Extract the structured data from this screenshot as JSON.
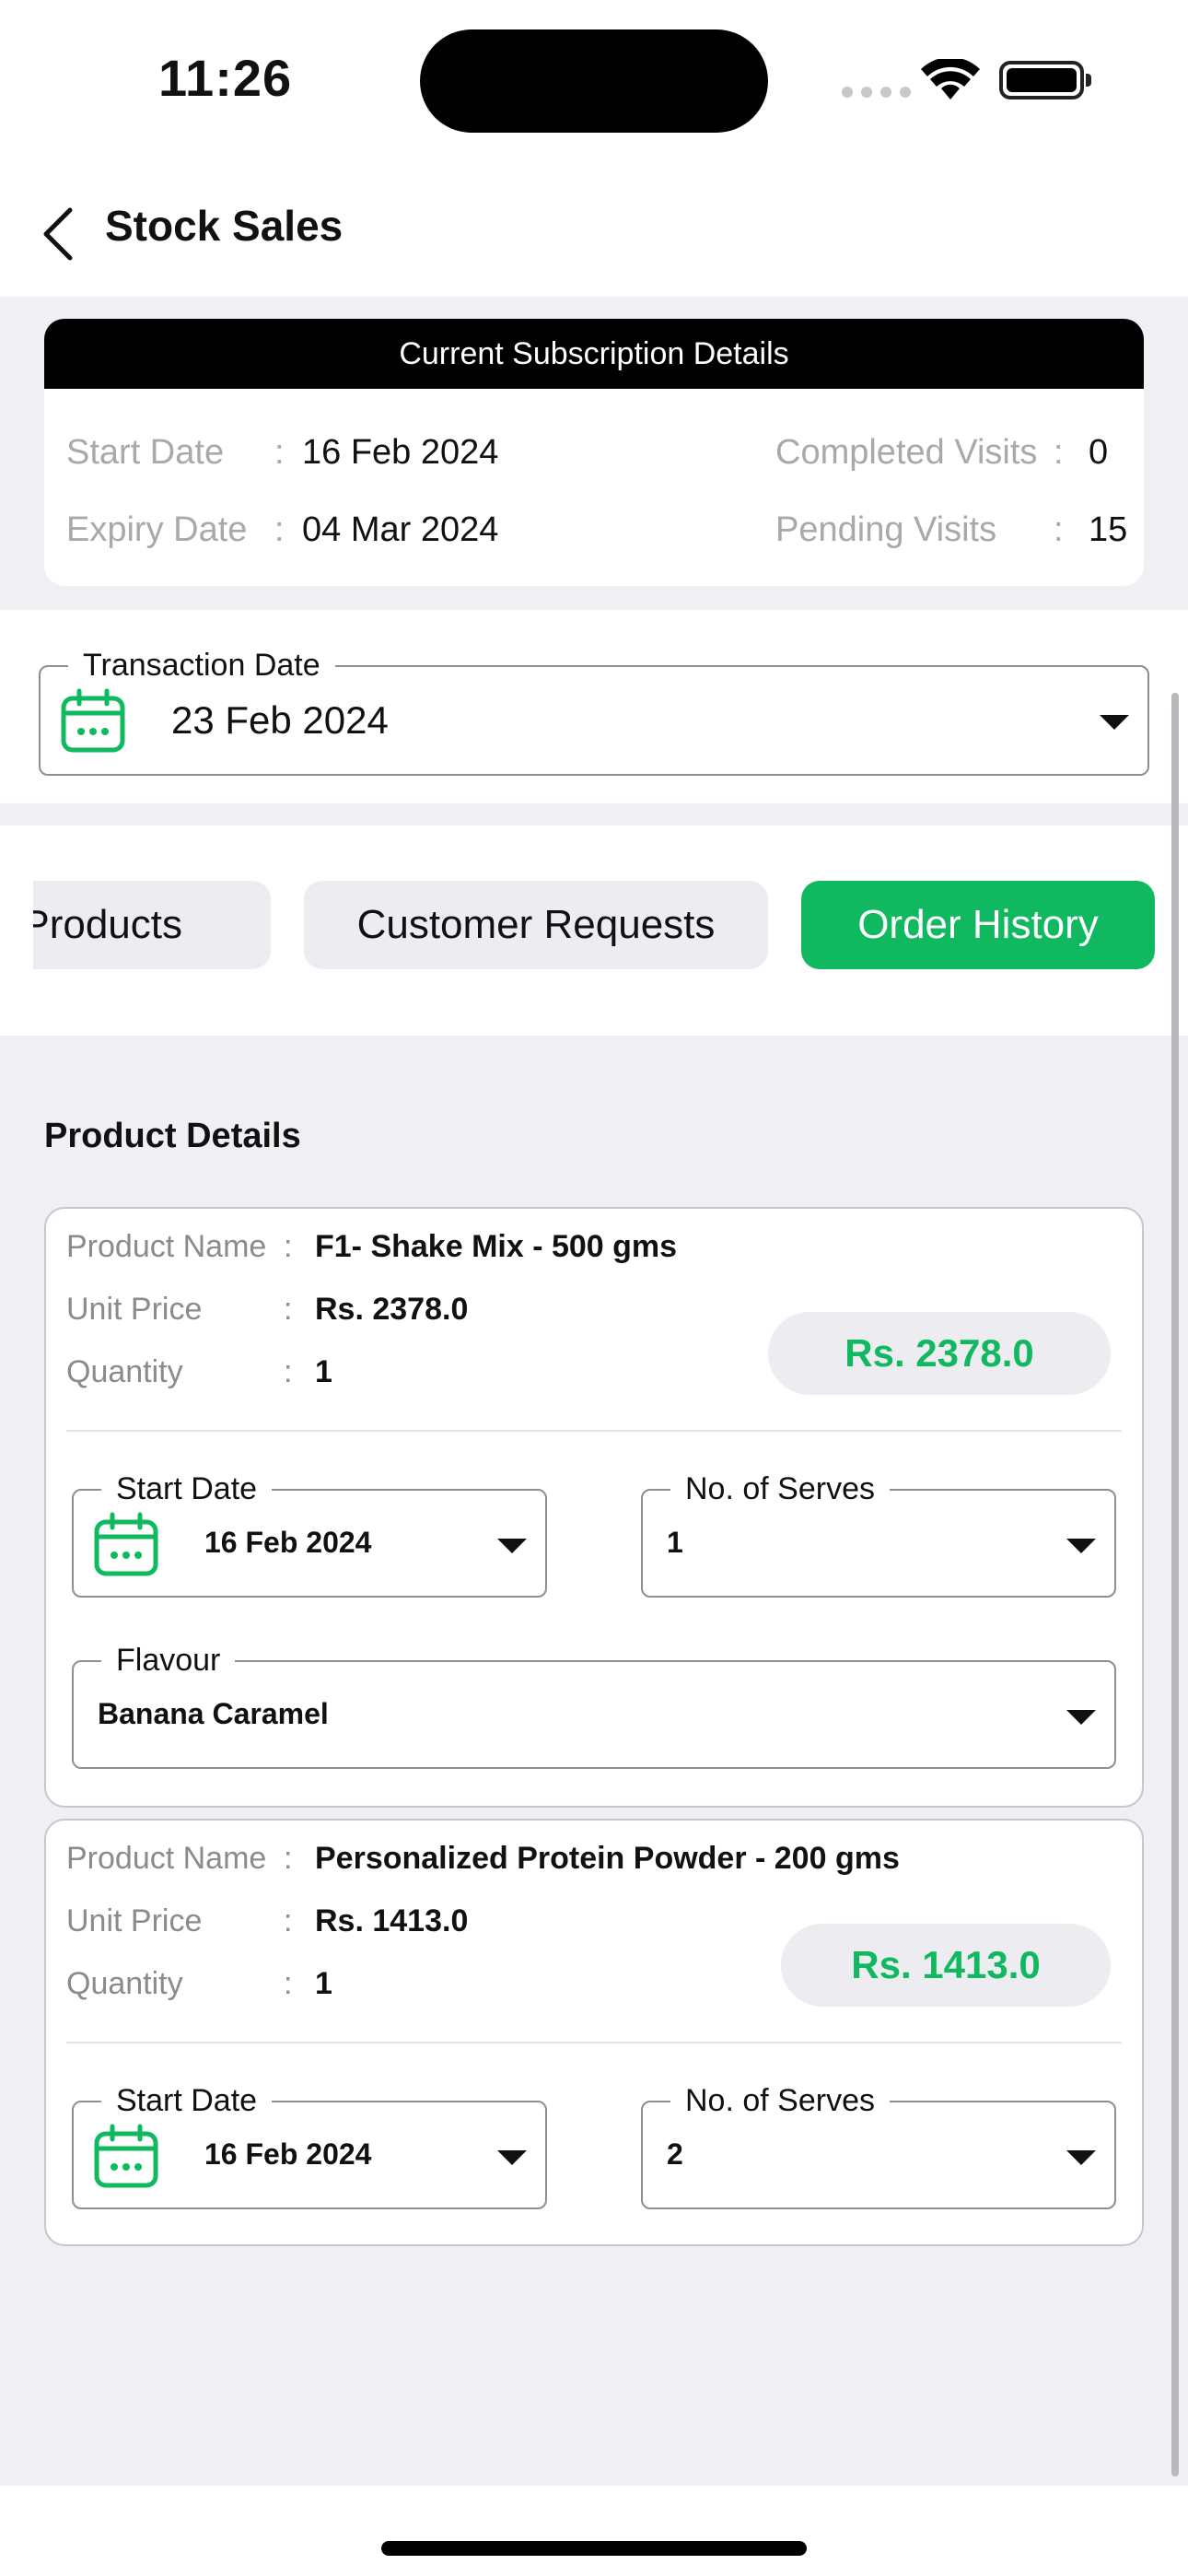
{
  "status_bar": {
    "time": "11:26"
  },
  "header": {
    "title": "Stock Sales"
  },
  "subscription": {
    "heading": "Current Subscription Details",
    "start_date_label": "Start Date",
    "start_date": "16 Feb 2024",
    "expiry_date_label": "Expiry Date",
    "expiry_date": "04 Mar 2024",
    "completed_visits_label": "Completed Visits",
    "completed_visits": "0",
    "pending_visits_label": "Pending Visits",
    "pending_visits": "15",
    "colon": ":"
  },
  "transaction": {
    "label": "Transaction Date",
    "value": "23 Feb 2024"
  },
  "tabs": [
    {
      "label": "Products",
      "active": false
    },
    {
      "label": "Customer Requests",
      "active": false
    },
    {
      "label": "Order History",
      "active": true
    }
  ],
  "product_details_title": "Product Details",
  "labels": {
    "product_name": "Product Name",
    "unit_price": "Unit Price",
    "quantity": "Quantity",
    "colon": ":",
    "start_date": "Start Date",
    "serves": "No. of Serves",
    "flavour": "Flavour"
  },
  "products": [
    {
      "name": "F1-  Shake Mix - 500 gms",
      "unit_price": "Rs. 2378.0",
      "quantity": "1",
      "total": "Rs. 2378.0",
      "start_date": "16 Feb 2024",
      "serves": "1",
      "flavour": "Banana Caramel"
    },
    {
      "name": "Personalized Protein Powder - 200 gms",
      "unit_price": "Rs. 1413.0",
      "quantity": "1",
      "total": "Rs. 1413.0",
      "start_date": "16 Feb 2024",
      "serves": "2"
    }
  ],
  "colors": {
    "accent": "#10b860",
    "header_bg": "#000000",
    "page_bg": "#efeff4"
  }
}
